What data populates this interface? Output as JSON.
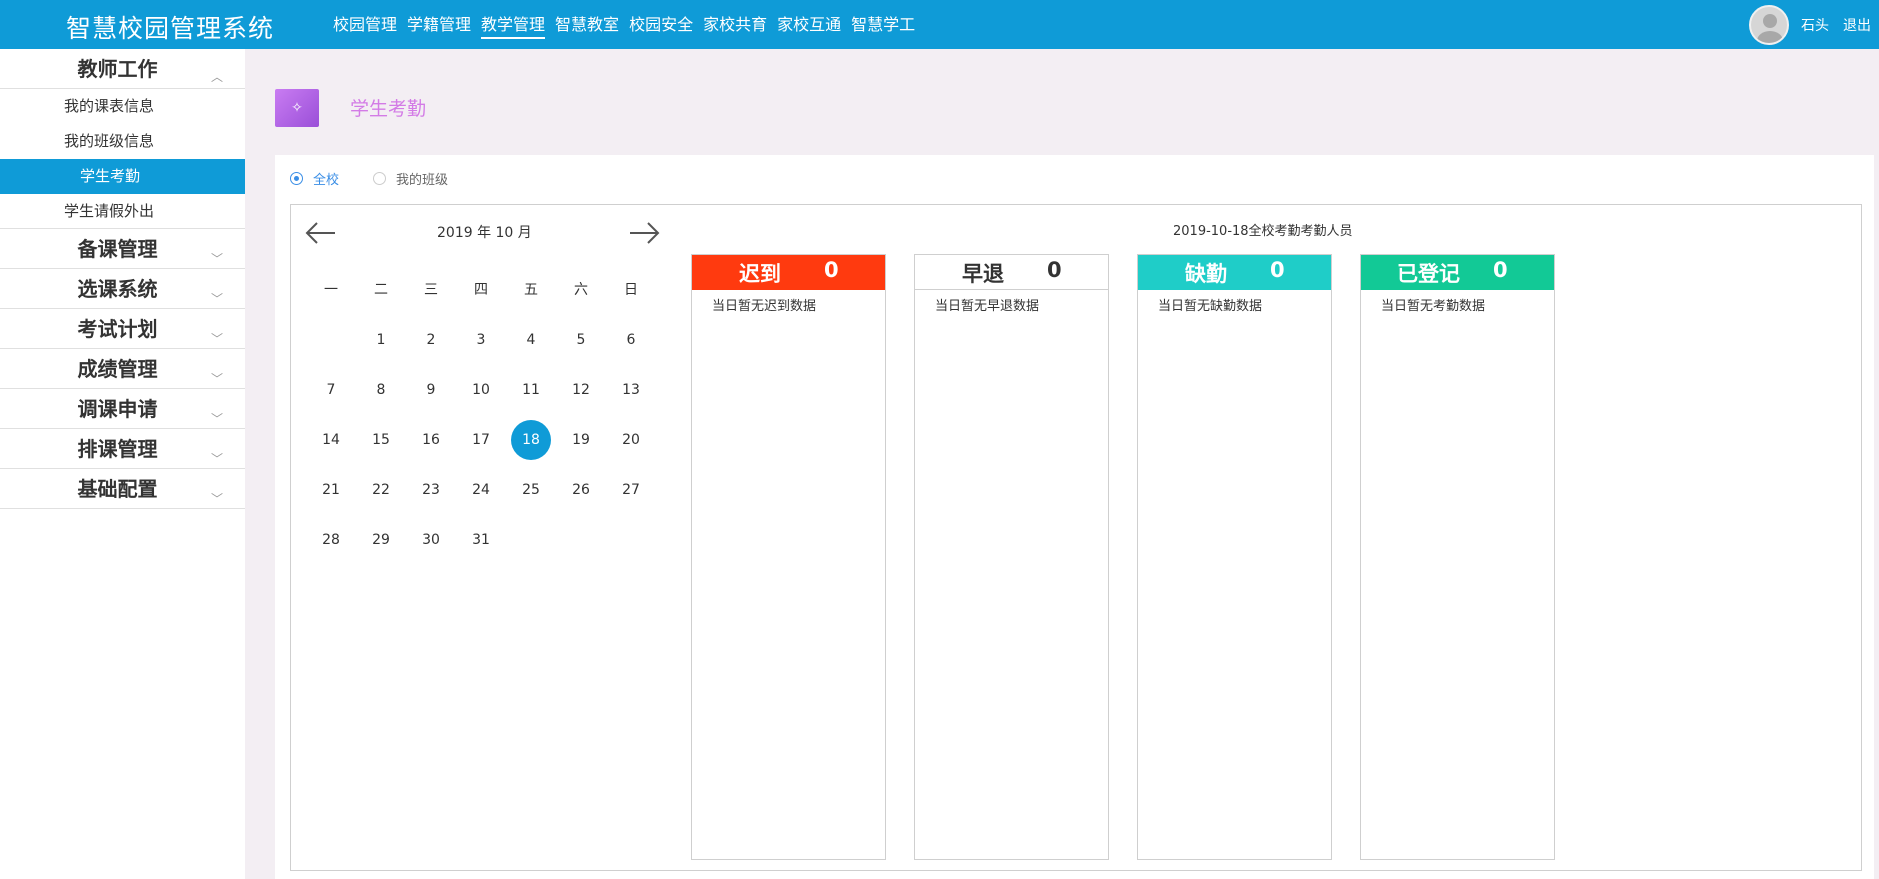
{
  "header": {
    "title": "智慧校园管理系统",
    "nav": [
      {
        "label": "校园管理",
        "active": false
      },
      {
        "label": "学籍管理",
        "active": false
      },
      {
        "label": "教学管理",
        "active": true
      },
      {
        "label": "智慧教室",
        "active": false
      },
      {
        "label": "校园安全",
        "active": false
      },
      {
        "label": "家校共育",
        "active": false
      },
      {
        "label": "家校互通",
        "active": false
      },
      {
        "label": "智慧学工",
        "active": false
      }
    ],
    "user_name": "石头",
    "logout": "退出"
  },
  "sidebar": {
    "open_group": {
      "label": "教师工作",
      "chevron": "chevron-up-icon",
      "items": [
        {
          "label": "我的课表信息",
          "active": false
        },
        {
          "label": "我的班级信息",
          "active": false
        },
        {
          "label": "学生考勤",
          "active": true
        },
        {
          "label": "学生请假外出",
          "active": false
        }
      ]
    },
    "groups": [
      {
        "label": "备课管理",
        "chevron": "chevron-down-icon"
      },
      {
        "label": "选课系统",
        "chevron": "chevron-down-icon"
      },
      {
        "label": "考试计划",
        "chevron": "chevron-down-icon"
      },
      {
        "label": "成绩管理",
        "chevron": "chevron-down-icon"
      },
      {
        "label": "调课申请",
        "chevron": "chevron-down-icon"
      },
      {
        "label": "排课管理",
        "chevron": "chevron-down-icon"
      },
      {
        "label": "基础配置",
        "chevron": "chevron-down-icon"
      }
    ]
  },
  "page": {
    "icon": "sparkle-icon",
    "title": "学生考勤"
  },
  "scope": {
    "options": [
      {
        "label": "全校",
        "checked": true
      },
      {
        "label": "我的班级",
        "checked": false
      }
    ]
  },
  "calendar": {
    "title": "2019 年 10 月",
    "weekdays": [
      "一",
      "二",
      "三",
      "四",
      "五",
      "六",
      "日"
    ],
    "weeks": [
      [
        "",
        "1",
        "2",
        "3",
        "4",
        "5",
        "6"
      ],
      [
        "7",
        "8",
        "9",
        "10",
        "11",
        "12",
        "13"
      ],
      [
        "14",
        "15",
        "16",
        "17",
        "18",
        "19",
        "20"
      ],
      [
        "21",
        "22",
        "23",
        "24",
        "25",
        "26",
        "27"
      ],
      [
        "28",
        "29",
        "30",
        "31",
        "",
        "",
        ""
      ]
    ],
    "selected_day": "18"
  },
  "attendance": {
    "title": "2019-10-18全校考勤考勤人员",
    "cards": [
      {
        "label": "迟到",
        "count": "0",
        "color": "#ff3a0f",
        "text_color": "#ffffff",
        "empty": "当日暂无迟到数据"
      },
      {
        "label": "早退",
        "count": "0",
        "color": "#ffffff",
        "text_color": "#333333",
        "empty": "当日暂无早退数据"
      },
      {
        "label": "缺勤",
        "count": "0",
        "color": "#1fcdc8",
        "text_color": "#ffffff",
        "empty": "当日暂无缺勤数据"
      },
      {
        "label": "已登记",
        "count": "0",
        "color": "#12c996",
        "text_color": "#ffffff",
        "empty": "当日暂无考勤数据"
      }
    ]
  }
}
